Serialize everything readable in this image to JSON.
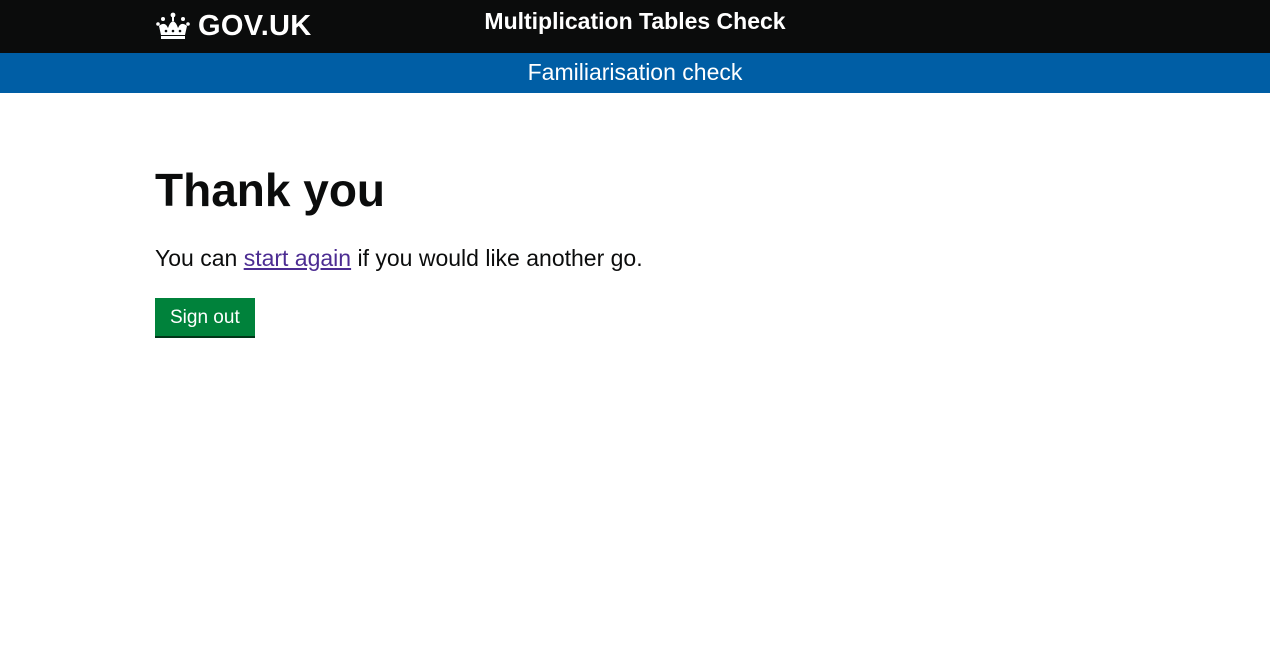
{
  "header": {
    "logo_text": "GOV.UK",
    "service_name": "Multiplication Tables Check"
  },
  "banner": {
    "text": "Familiarisation check"
  },
  "main": {
    "heading": "Thank you",
    "text_before_link": "You can ",
    "link_text": "start again",
    "text_after_link": " if you would like another go.",
    "button_label": "Sign out"
  },
  "colors": {
    "header_bg": "#0b0c0c",
    "banner_bg": "#005ea5",
    "link": "#4c2c92",
    "button_bg": "#00823b"
  }
}
